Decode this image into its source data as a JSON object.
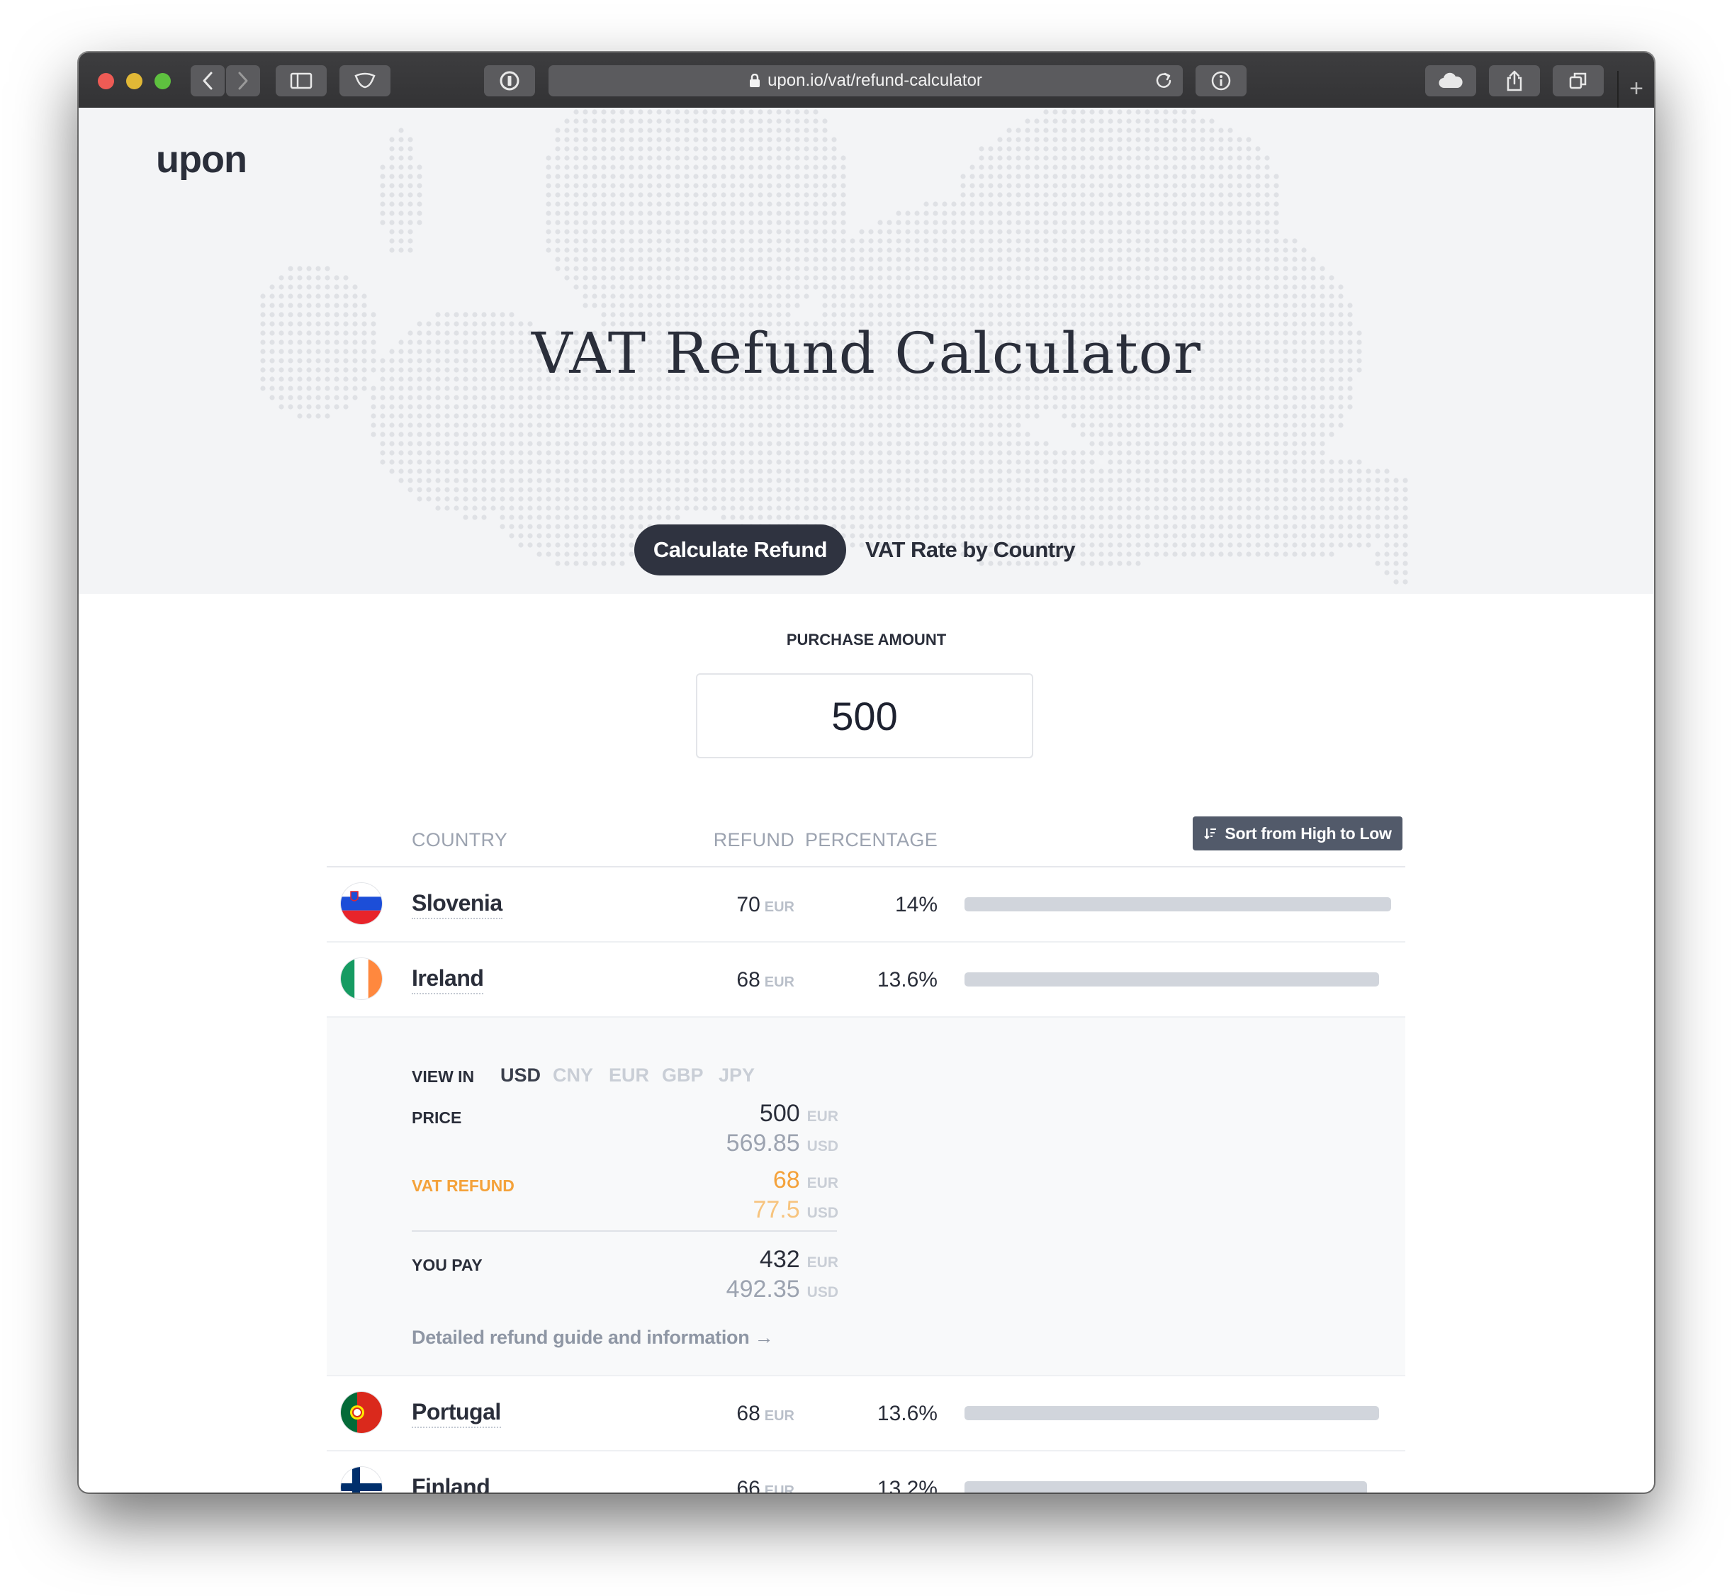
{
  "browser": {
    "url": "upon.io/vat/refund-calculator"
  },
  "logo": "upon",
  "title": "VAT Refund Calculator",
  "tabs": [
    "Calculate Refund",
    "VAT Rate by Country"
  ],
  "purchase": {
    "label": "PURCHASE AMOUNT",
    "value": "500"
  },
  "table": {
    "headers": {
      "country": "COUNTRY",
      "refund": "REFUND",
      "percentage": "PERCENTAGE"
    },
    "sort_label": "Sort from High to Low",
    "currency": "EUR",
    "rows": [
      {
        "country": "Slovenia",
        "refund": "70",
        "percentage": "14%",
        "bar_fraction": 1.0
      },
      {
        "country": "Ireland",
        "refund": "68",
        "percentage": "13.6%",
        "bar_fraction": 0.971
      },
      {
        "country": "Portugal",
        "refund": "68",
        "percentage": "13.6%",
        "bar_fraction": 0.971
      },
      {
        "country": "Finland",
        "refund": "66",
        "percentage": "13.2%",
        "bar_fraction": 0.943
      }
    ]
  },
  "details": {
    "view_in_label": "VIEW IN",
    "currencies": [
      "USD",
      "CNY",
      "EUR",
      "GBP",
      "JPY"
    ],
    "selected_currency": "USD",
    "price_label": "PRICE",
    "price_eur": "500",
    "price_usd": "569.85",
    "refund_label": "VAT REFUND",
    "refund_eur": "68",
    "refund_usd": "77.5",
    "pay_label": "YOU PAY",
    "pay_eur": "432",
    "pay_usd": "492.35",
    "eur": "EUR",
    "usd": "USD",
    "guide_link": "Detailed refund guide and information →"
  },
  "colors": {
    "accent_dark": "#2f3340",
    "refund_orange": "#f4a23b",
    "bar": "#d1d5dc"
  }
}
